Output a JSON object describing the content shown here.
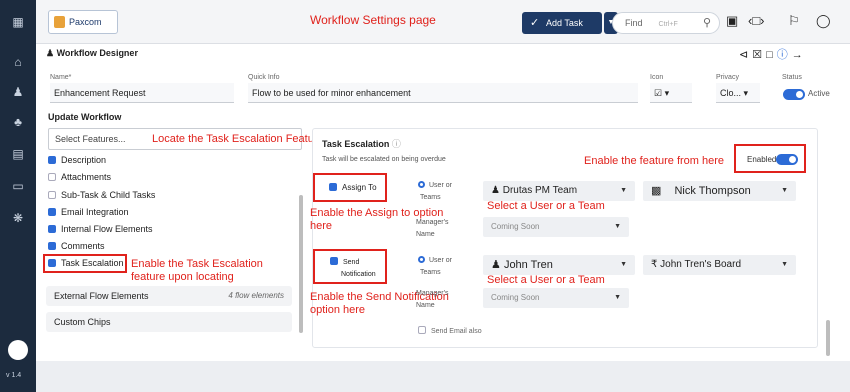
{
  "annotation_page_title": "Workflow Settings page",
  "brand": {
    "label": "Paxcom"
  },
  "topbar": {
    "add_task": "Add Task",
    "find_placeholder": "Find",
    "find_shortcut": "Ctrl+F"
  },
  "sidebar": {
    "version": "v 1.4"
  },
  "designer": {
    "title": "Workflow Designer"
  },
  "form": {
    "name_label": "Name*",
    "name_value": "Enhancement Request",
    "quick_info_label": "Quick Info",
    "quick_info_value": "Flow to be used for minor enhancement",
    "icon_label": "Icon",
    "privacy_label": "Privacy",
    "privacy_value": "Clo...",
    "status_label": "Status",
    "status_value": "Active"
  },
  "update": {
    "title": "Update Workflow",
    "select_placeholder": "Select Features...",
    "features": [
      {
        "label": "Description",
        "checked": true
      },
      {
        "label": "Attachments",
        "checked": false
      },
      {
        "label": "Sub-Task & Child Tasks",
        "checked": false
      },
      {
        "label": "Email Integration",
        "checked": true
      },
      {
        "label": "Internal Flow Elements",
        "checked": true
      },
      {
        "label": "Comments",
        "checked": true
      },
      {
        "label": "Task Escalation",
        "checked": true
      }
    ],
    "external_label": "External Flow Elements",
    "external_count": "4 flow elements",
    "custom_chips": "Custom Chips"
  },
  "escalation": {
    "title": "Task Escalation",
    "subtitle": "Task will be escalated on being overdue",
    "enabled_label": "Enabled",
    "assign_to": "Assign To",
    "send_label_1": "Send",
    "send_label_2": "Notification",
    "radio_label_1": "User or",
    "radio_label_2": "Teams",
    "managers_1": "Manager's",
    "managers_2": "Name",
    "assign_team": "Drutas PM Team",
    "assign_user": "Nick Thompson",
    "assign_coming": "Coming Soon",
    "send_user": "John Tren",
    "send_board": "John Tren's Board",
    "send_coming": "Coming Soon",
    "send_email": "Send Email also"
  },
  "annotations": {
    "locate": "Locate the Task Escalation Feature here",
    "enable_feature": "Enable the feature from here",
    "assign_option_1": "Enable the Assign to option",
    "assign_option_2": "here",
    "select_user_1": "Select a User or a Team",
    "escalation_locate_1": "Enable the Task Escalation",
    "escalation_locate_2": "feature upon locating",
    "send_option_1": "Enable the Send Notification",
    "send_option_2": "option  here",
    "select_user_2": "Select a User or a Team"
  },
  "colors": {
    "accent": "#2c6bd6",
    "annotation": "#e0221c",
    "sidebar": "#1c2b3e",
    "button": "#1e3a66"
  }
}
